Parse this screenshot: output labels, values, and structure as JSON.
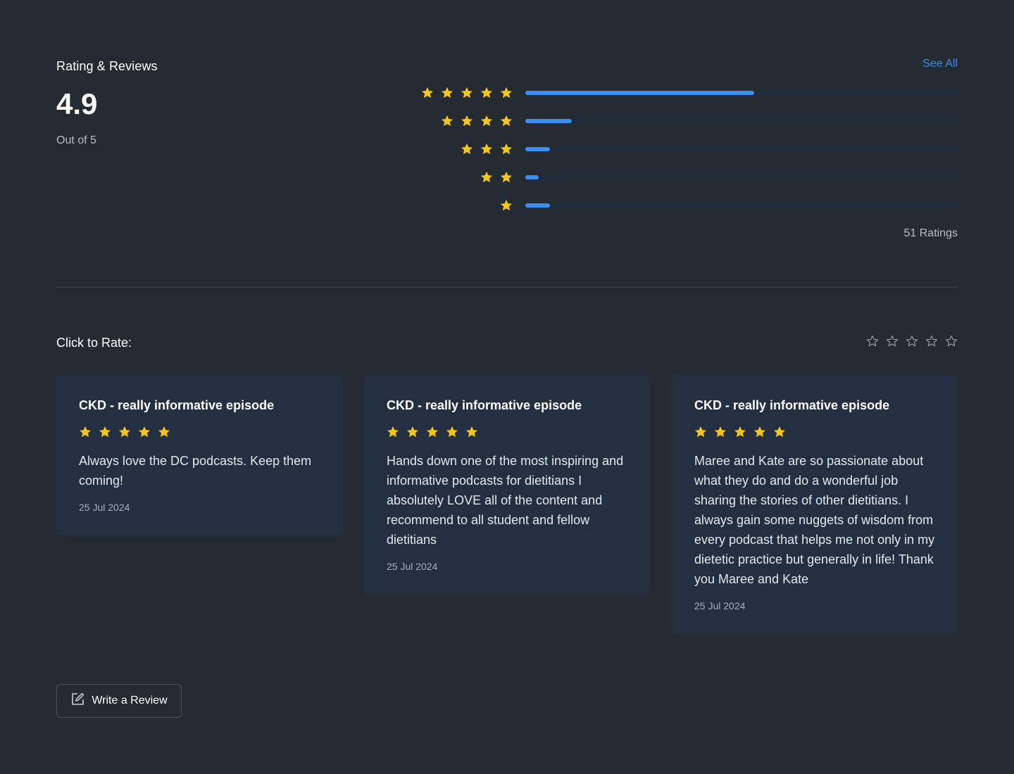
{
  "section": {
    "title": "Rating & Reviews",
    "see_all_label": "See All",
    "score": "4.9",
    "out_of": "Out of 5",
    "ratings_count": "51 Ratings"
  },
  "distribution": [
    {
      "stars": 5,
      "fraction": 0.53
    },
    {
      "stars": 4,
      "fraction": 0.107
    },
    {
      "stars": 3,
      "fraction": 0.057
    },
    {
      "stars": 2,
      "fraction": 0.032
    },
    {
      "stars": 1,
      "fraction": 0.057
    }
  ],
  "rate": {
    "label": "Click to Rate:",
    "star_count": 5
  },
  "reviews": [
    {
      "title": "CKD - really informative episode",
      "stars": 5,
      "text": "Always love the DC podcasts. Keep them coming!",
      "date": "25 Jul 2024"
    },
    {
      "title": "CKD - really informative episode",
      "stars": 5,
      "text": "Hands down one of the most inspiring and informative podcasts for dietitians I absolutely LOVE all of the content and recommend to all student and fellow dietitians",
      "date": "25 Jul 2024"
    },
    {
      "title": "CKD - really informative episode",
      "stars": 5,
      "text": "Maree and Kate are so passionate about what they do and do a wonderful job sharing the stories of other dietitians. I always gain some nuggets of wisdom from every podcast that helps me not only in my dietetic practice but generally in life! Thank you Maree and Kate",
      "date": "25 Jul 2024"
    }
  ],
  "write_review_label": "Write a Review",
  "colors": {
    "background": "#252b33",
    "card": "#243042",
    "accent": "#3b8ff0",
    "star": "#f5c518",
    "track": "#1f2a3b"
  },
  "icons": {
    "filled_star": "star-icon",
    "empty_star": "star-outline-icon",
    "edit": "edit-icon"
  }
}
